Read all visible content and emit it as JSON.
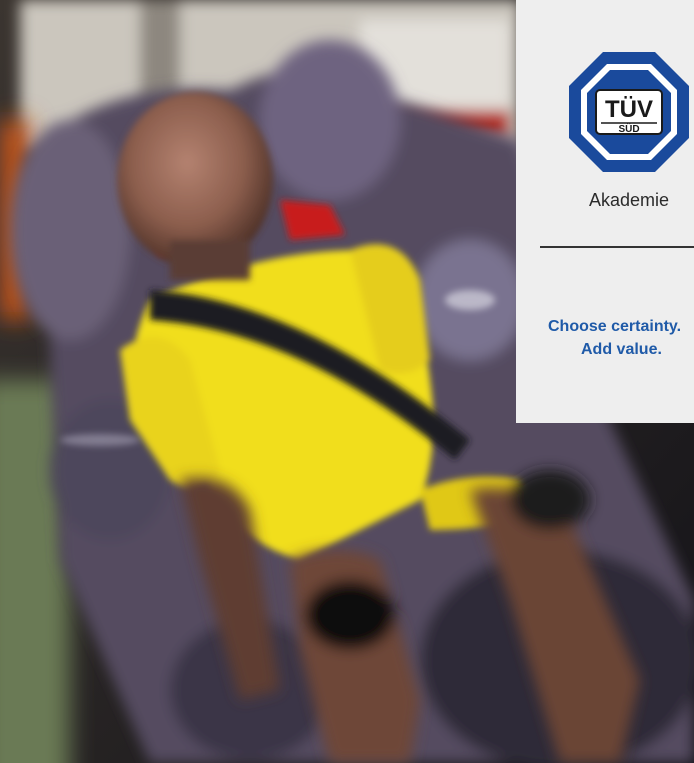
{
  "logo": {
    "icon": "tuv-sud-octagon-logo",
    "brand_top": "TÜV",
    "brand_bottom": "SÜD",
    "label": "Akademie",
    "colors": {
      "octagon_blue": "#1a4a9c",
      "ring_white": "#ffffff",
      "inner_white": "#ffffff",
      "text": "#1a1a1a"
    }
  },
  "tagline": {
    "line1": "Choose certainty.",
    "line2": "Add value."
  },
  "photo": {
    "subject": "crash test dummy in child car seat"
  },
  "colors": {
    "panel_bg": "#eeeeee",
    "tagline_blue": "#1f5aa8",
    "dummy_yellow": "#f1de1f"
  }
}
